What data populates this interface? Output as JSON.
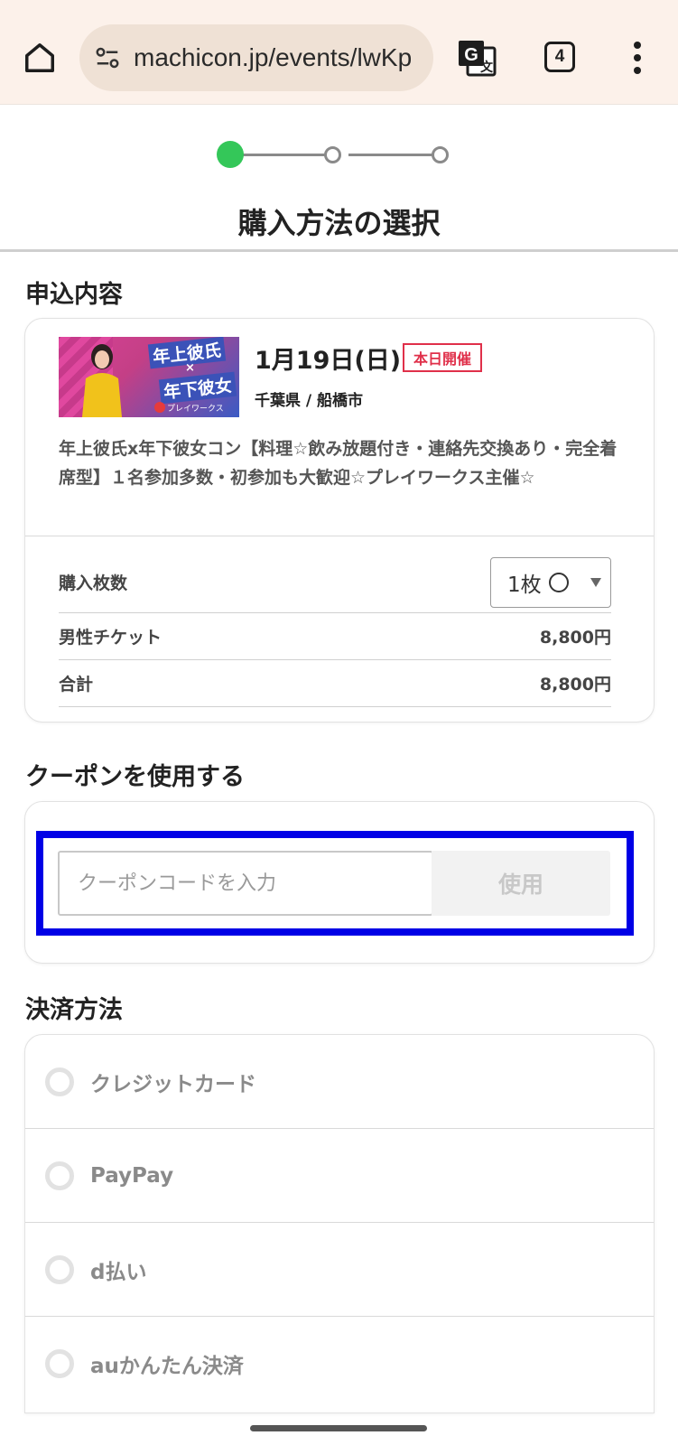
{
  "browser": {
    "url": "machicon.jp/events/lwKp",
    "tab_count": "4",
    "colors": {
      "toolbar_bg": "#fcf1ea",
      "urlbar_bg": "#efe1d5"
    }
  },
  "stepper": {
    "current_step": 1,
    "total_steps": 3,
    "active_color": "#34c759"
  },
  "page_title": "購入方法の選択",
  "order": {
    "heading": "申込内容",
    "event": {
      "image_text_1": "年上彼氏",
      "image_text_x": "×",
      "image_text_2": "年下彼女",
      "image_logo_text": "プレイワークス",
      "date": "1月19日(日)",
      "badge": "本日開催",
      "location": "千葉県 / 船橋市",
      "description": "年上彼氏x年下彼女コン【料理☆飲み放題付き・連絡先交換あり・完全着席型】１名参加多数・初参加も大歓迎☆プレイワークス主催☆"
    },
    "quantity": {
      "label": "購入枚数",
      "value": "1枚"
    },
    "ticket": {
      "label": "男性チケット",
      "price": "8,800円"
    },
    "total": {
      "label": "合計",
      "price": "8,800円"
    }
  },
  "coupon": {
    "heading": "クーポンを使用する",
    "placeholder": "クーポンコードを入力",
    "button": "使用",
    "highlight_color": "#0000e6"
  },
  "payment": {
    "heading": "決済方法",
    "methods": [
      "クレジットカード",
      "PayPay",
      "d払い",
      "auかんたん決済"
    ]
  }
}
